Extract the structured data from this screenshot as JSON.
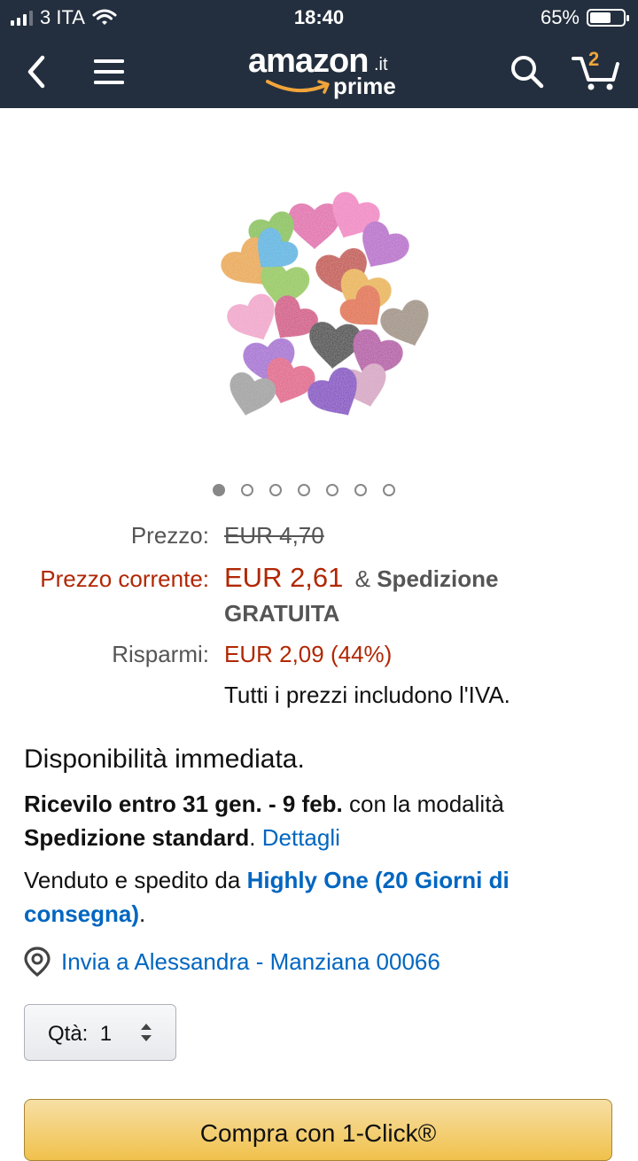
{
  "status": {
    "carrier": "3 ITA",
    "time": "18:40",
    "battery": "65%",
    "battery_level": 0.65
  },
  "nav": {
    "logo_word": "amazon",
    "logo_tld": ".it",
    "logo_prime": "prime",
    "cart_count": "2",
    "icons": [
      "chevron-left-icon",
      "menu-icon",
      "search-icon",
      "cart-icon"
    ]
  },
  "carousel": {
    "dot_count": 7,
    "active_index": 0
  },
  "price": {
    "list_label": "Prezzo:",
    "list_value": "EUR 4,70",
    "current_label": "Prezzo corrente:",
    "current_value": "EUR 2,61",
    "shipping_amp": "&",
    "shipping_line1": "Spedizione",
    "shipping_line2": "GRATUITA",
    "savings_label": "Risparmi:",
    "savings_value": "EUR 2,09 (44%)",
    "vat_note": "Tutti i prezzi includono l'IVA."
  },
  "availability": {
    "status": "Disponibilità immediata.",
    "delivery_bold": "Ricevilo entro 31 gen. - 9 feb.",
    "delivery_text": "con la modalità",
    "delivery_method": "Spedizione standard",
    "delivery_period": ".",
    "details_link": "Dettagli",
    "sold_by_text": "Venduto e spedito da",
    "seller_line1": "Highly One (20 Giorni di",
    "seller_line2": "consegna)",
    "seller_period": "."
  },
  "location": {
    "text": "Invia a Alessandra - Manziana 00066"
  },
  "quantity": {
    "label": "Qtà:",
    "value": "1"
  },
  "buy_button": {
    "label": "Compra con 1-Click®"
  },
  "colors": {
    "header_bg": "#232f3e",
    "price_red": "#b12704",
    "available_green": "#007600",
    "link_blue": "#0066c0",
    "button_yellow": "#f0c14b"
  }
}
